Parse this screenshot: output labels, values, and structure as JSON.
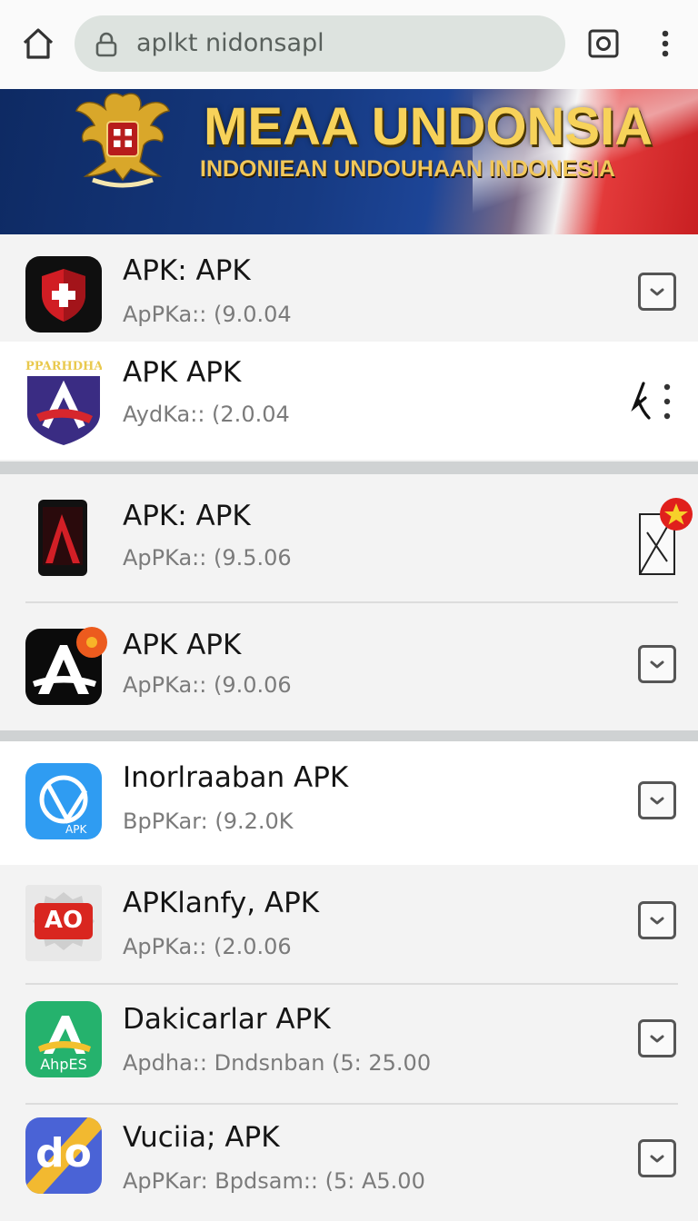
{
  "browser": {
    "url": "aplkt nidonsapl"
  },
  "banner": {
    "title": "MEAA UNDONSIA",
    "subtitle": "INDONIEAN UNDOUHAAN INDONESIA"
  },
  "apps": [
    {
      "title": "APK: APK",
      "subtitle": "ApPKa:: (9.0.04",
      "icon_text": ""
    },
    {
      "title": "APK APK",
      "subtitle": "AydKa:: (2.0.04",
      "icon_text": "PPARHDHAIN"
    },
    {
      "title": "APK: APK",
      "subtitle": "ApPKa:: (9.5.06",
      "icon_text": ""
    },
    {
      "title": "APK APK",
      "subtitle": "ApPKa:: (9.0.06",
      "icon_text": ""
    },
    {
      "title": "Inorlraaban APK",
      "subtitle": "BpPKar: (9.2.0K",
      "icon_text": "APK"
    },
    {
      "title": "APKlanfy, APK",
      "subtitle": "ApPKa:: (2.0.06",
      "icon_text": "AO"
    },
    {
      "title": "Dakicarlar APK",
      "subtitle": "Apdha:: Dndsnban  (5: 25.00",
      "icon_text": "AhpES"
    },
    {
      "title": "Vuciia; APK",
      "subtitle": "ApPKar: Bpdsam:: (5: A5.00",
      "icon_text": "do"
    }
  ],
  "colors": {
    "banner_gold": "#f7d25a",
    "banner_blue": "#163a82",
    "flag_red": "#c81f22"
  }
}
